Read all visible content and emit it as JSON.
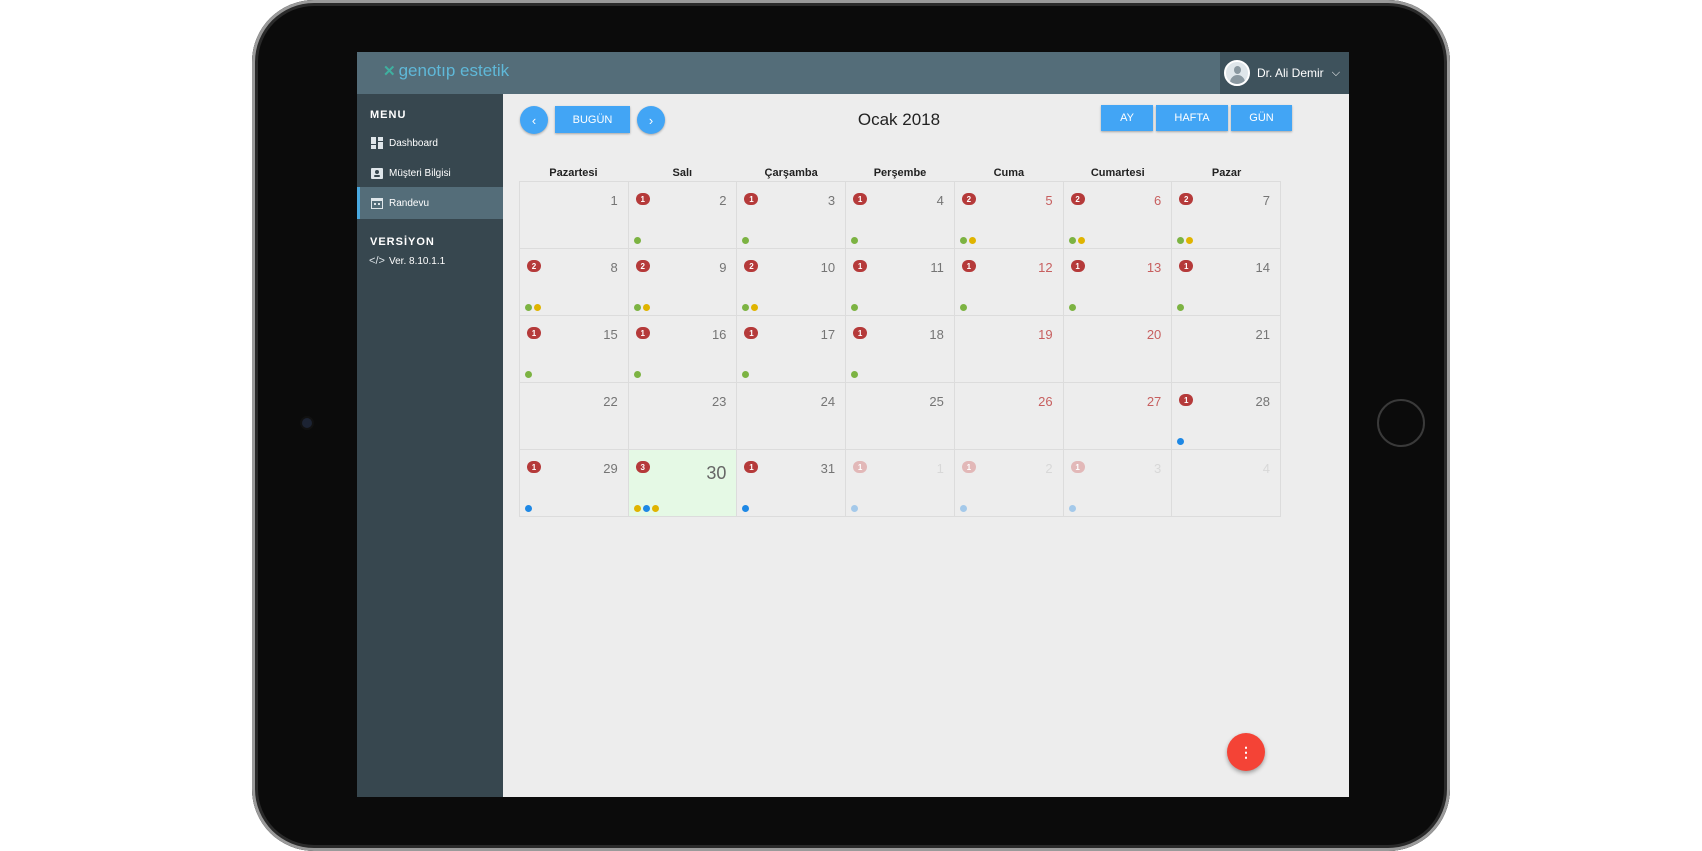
{
  "app": {
    "logo_text": "genotıp estetik",
    "user_name": "Dr. Ali Demir"
  },
  "sidebar": {
    "menu_heading": "MENU",
    "items": [
      {
        "label": "Dashboard",
        "icon": "dashboard-icon"
      },
      {
        "label": "Müşteri Bilgisi",
        "icon": "contact-card-icon"
      },
      {
        "label": "Randevu",
        "icon": "calendar-icon",
        "active": true
      }
    ],
    "version_heading": "VERSİYON",
    "version_label": "Ver. 8.10.1.1",
    "version_icon": "code-icon"
  },
  "toolbar": {
    "prev_icon": "chevron-left-icon",
    "today_label": "BUGÜN",
    "next_icon": "chevron-right-icon",
    "month_title": "Ocak 2018",
    "view_buttons": [
      "AY",
      "HAFTA",
      "GÜN"
    ]
  },
  "colors": {
    "accent": "#42a5f5",
    "badge": "#b53a3a",
    "dot_green": "#7cb342",
    "dot_yellow": "#e0b400",
    "dot_blue": "#1e88e5",
    "fab": "#f44336"
  },
  "calendar": {
    "weekdays": [
      "Pazartesi",
      "Salı",
      "Çarşamba",
      "Perşembe",
      "Cuma",
      "Cumartesi",
      "Pazar"
    ],
    "days": [
      {
        "day": "1",
        "badge": "",
        "dots": []
      },
      {
        "day": "2",
        "badge": "1",
        "dots": [
          "green"
        ]
      },
      {
        "day": "3",
        "badge": "1",
        "dots": [
          "green"
        ]
      },
      {
        "day": "4",
        "badge": "1",
        "dots": [
          "green"
        ]
      },
      {
        "day": "5",
        "badge": "2",
        "dots": [
          "green",
          "yellow"
        ]
      },
      {
        "day": "6",
        "badge": "2",
        "dots": [
          "green",
          "yellow"
        ]
      },
      {
        "day": "7",
        "badge": "2",
        "dots": [
          "green",
          "yellow"
        ]
      },
      {
        "day": "8",
        "badge": "2",
        "dots": [
          "green",
          "yellow"
        ]
      },
      {
        "day": "9",
        "badge": "2",
        "dots": [
          "green",
          "yellow"
        ]
      },
      {
        "day": "10",
        "badge": "2",
        "dots": [
          "green",
          "yellow"
        ]
      },
      {
        "day": "11",
        "badge": "1",
        "dots": [
          "green"
        ]
      },
      {
        "day": "12",
        "badge": "1",
        "dots": [
          "green"
        ]
      },
      {
        "day": "13",
        "badge": "1",
        "dots": [
          "green"
        ]
      },
      {
        "day": "14",
        "badge": "1",
        "dots": [
          "green"
        ]
      },
      {
        "day": "15",
        "badge": "1",
        "dots": [
          "green"
        ]
      },
      {
        "day": "16",
        "badge": "1",
        "dots": [
          "green"
        ]
      },
      {
        "day": "17",
        "badge": "1",
        "dots": [
          "green"
        ]
      },
      {
        "day": "18",
        "badge": "1",
        "dots": [
          "green"
        ]
      },
      {
        "day": "19",
        "badge": "",
        "dots": []
      },
      {
        "day": "20",
        "badge": "",
        "dots": []
      },
      {
        "day": "21",
        "badge": "",
        "dots": []
      },
      {
        "day": "22",
        "badge": "",
        "dots": []
      },
      {
        "day": "23",
        "badge": "",
        "dots": []
      },
      {
        "day": "24",
        "badge": "",
        "dots": []
      },
      {
        "day": "25",
        "badge": "",
        "dots": []
      },
      {
        "day": "26",
        "badge": "",
        "dots": []
      },
      {
        "day": "27",
        "badge": "",
        "dots": []
      },
      {
        "day": "28",
        "badge": "1",
        "dots": [
          "blue"
        ]
      },
      {
        "day": "29",
        "badge": "1",
        "dots": [
          "blue"
        ]
      },
      {
        "day": "30",
        "badge": "3",
        "dots": [
          "yellow",
          "blue",
          "yellow"
        ],
        "today": true
      },
      {
        "day": "31",
        "badge": "1",
        "dots": [
          "blue"
        ]
      },
      {
        "day": "1",
        "badge": "1",
        "dots": [
          "blue"
        ],
        "other_month": true
      },
      {
        "day": "2",
        "badge": "1",
        "dots": [
          "blue"
        ],
        "other_month": true
      },
      {
        "day": "3",
        "badge": "1",
        "dots": [
          "blue"
        ],
        "other_month": true
      },
      {
        "day": "4",
        "badge": "",
        "dots": [],
        "other_month": true
      }
    ]
  },
  "fab_icon": "more-vertical-icon"
}
